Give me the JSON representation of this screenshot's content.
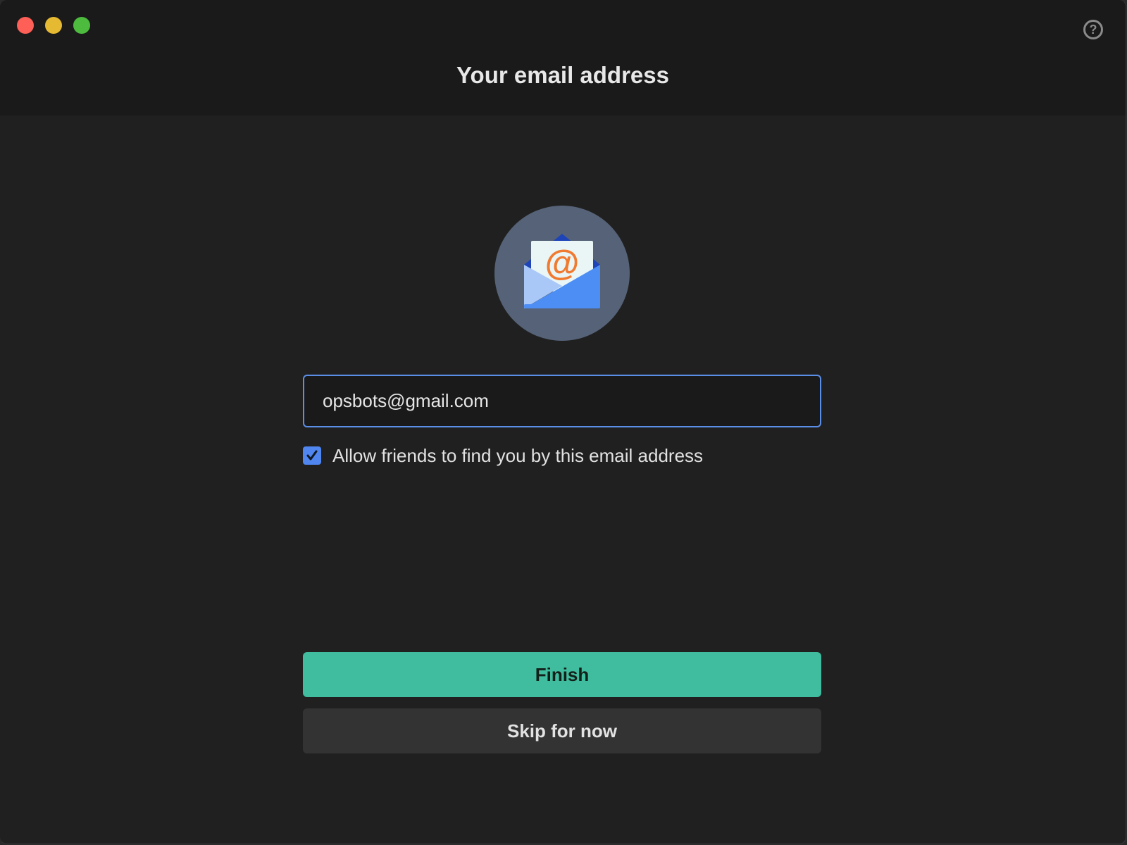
{
  "window": {
    "title": "Your email address"
  },
  "email": {
    "value": "opsbots@gmail.com",
    "at_glyph": "@"
  },
  "options": {
    "allow_find_label": "Allow friends to find you by this email address",
    "allow_find_checked": true
  },
  "actions": {
    "finish_label": "Finish",
    "skip_label": "Skip for now"
  },
  "help": {
    "glyph": "?"
  },
  "colors": {
    "accent": "#5b8ee6",
    "finish": "#3fbd9e",
    "checkbox": "#4f86f0",
    "close": "#fe5f57",
    "minimize": "#e6b932",
    "maximize": "#4dbb3e"
  }
}
